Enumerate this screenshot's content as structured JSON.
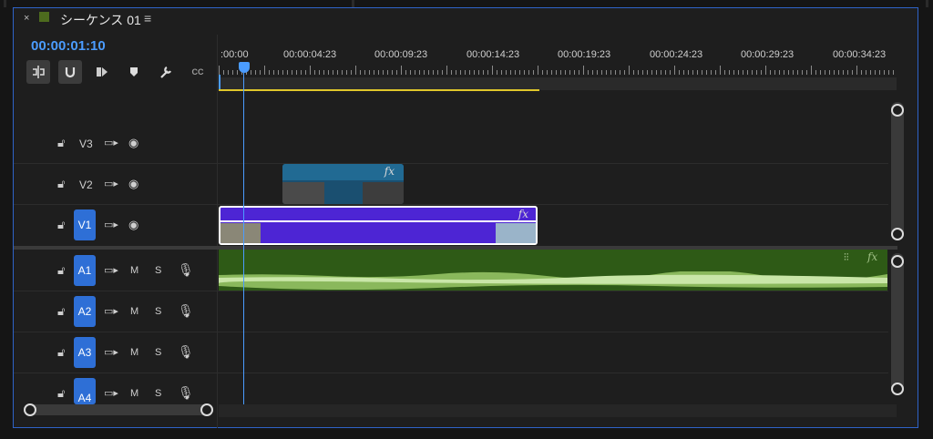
{
  "panel": {
    "close": "×",
    "title": "シーケンス 01",
    "menu": "≡",
    "timecode": "00:00:01:10"
  },
  "toolbar": {
    "tools": [
      "insert-edit-icon",
      "snap-magnet-icon",
      "linked-selection-icon",
      "add-marker-icon",
      "wrench-settings-icon",
      "captions-icon"
    ],
    "captions_label": "CC"
  },
  "ruler": {
    "labels": [
      ":00:00",
      "00:00:04:23",
      "00:00:09:23",
      "00:00:14:23",
      "00:00:19:23",
      "00:00:24:23",
      "00:00:29:23",
      "00:00:34:23"
    ]
  },
  "tracks": {
    "video": [
      {
        "name": "V3",
        "targeted": false
      },
      {
        "name": "V2",
        "targeted": false
      },
      {
        "name": "V1",
        "targeted": true
      }
    ],
    "audio": [
      {
        "name": "A1",
        "mute": "M",
        "solo": "S"
      },
      {
        "name": "A2",
        "mute": "M",
        "solo": "S"
      },
      {
        "name": "A3",
        "mute": "M",
        "solo": "S"
      },
      {
        "name": "A4",
        "mute": "M",
        "solo": "S"
      }
    ]
  },
  "clips": {
    "fx_label": "fx"
  },
  "colors": {
    "accent": "#4b9cff",
    "video_clip_v1": "#4d25d4",
    "video_clip_v2": "#216a93",
    "audio_clip": "#2e5a16",
    "work_area": "#e0c72b",
    "sequence_swatch": "#4d6b1e"
  }
}
